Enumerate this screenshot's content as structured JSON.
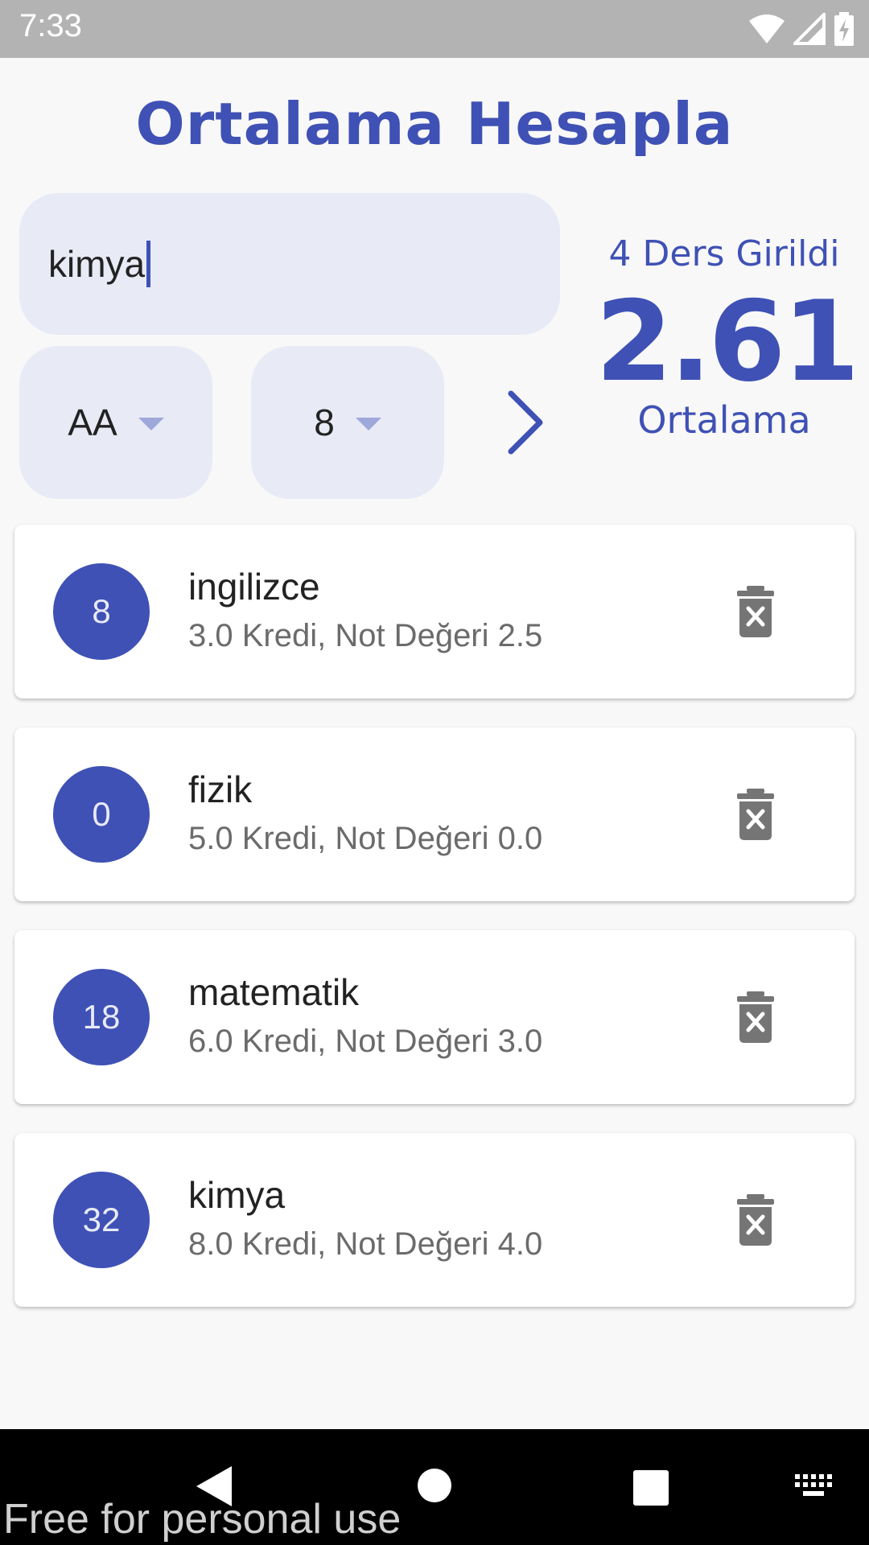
{
  "status_bar": {
    "time": "7:33",
    "icons": [
      "wifi-icon",
      "signal-icon",
      "battery-charging-icon"
    ]
  },
  "app": {
    "title": "Ortalama Hesapla"
  },
  "form": {
    "lesson_name_value": "kimya",
    "letter_grade_value": "AA",
    "credit_value": "8",
    "add_icon": "chevron-right-icon"
  },
  "summary": {
    "lessons_entered": "4 Ders Girildi",
    "average": "2.61",
    "average_label": "Ortalama"
  },
  "lessons": [
    {
      "badge": "8",
      "name": "ingilizce",
      "details": "3.0 Kredi, Not Değeri 2.5",
      "delete_icon": "delete-forever-icon"
    },
    {
      "badge": "0",
      "name": "fizik",
      "details": "5.0 Kredi, Not Değeri 0.0",
      "delete_icon": "delete-forever-icon"
    },
    {
      "badge": "18",
      "name": "matematik",
      "details": "6.0 Kredi, Not Değeri 3.0",
      "delete_icon": "delete-forever-icon"
    },
    {
      "badge": "32",
      "name": "kimya",
      "details": "8.0 Kredi, Not Değeri 4.0",
      "delete_icon": "delete-forever-icon"
    }
  ],
  "nav_bar": {
    "icons": [
      "back-icon",
      "home-icon",
      "recents-icon",
      "keyboard-icon"
    ]
  },
  "watermark": "Free for personal use",
  "colors": {
    "accent": "#3f51b5",
    "field_background": "#e8eaf6",
    "background": "#f8f8f8"
  }
}
